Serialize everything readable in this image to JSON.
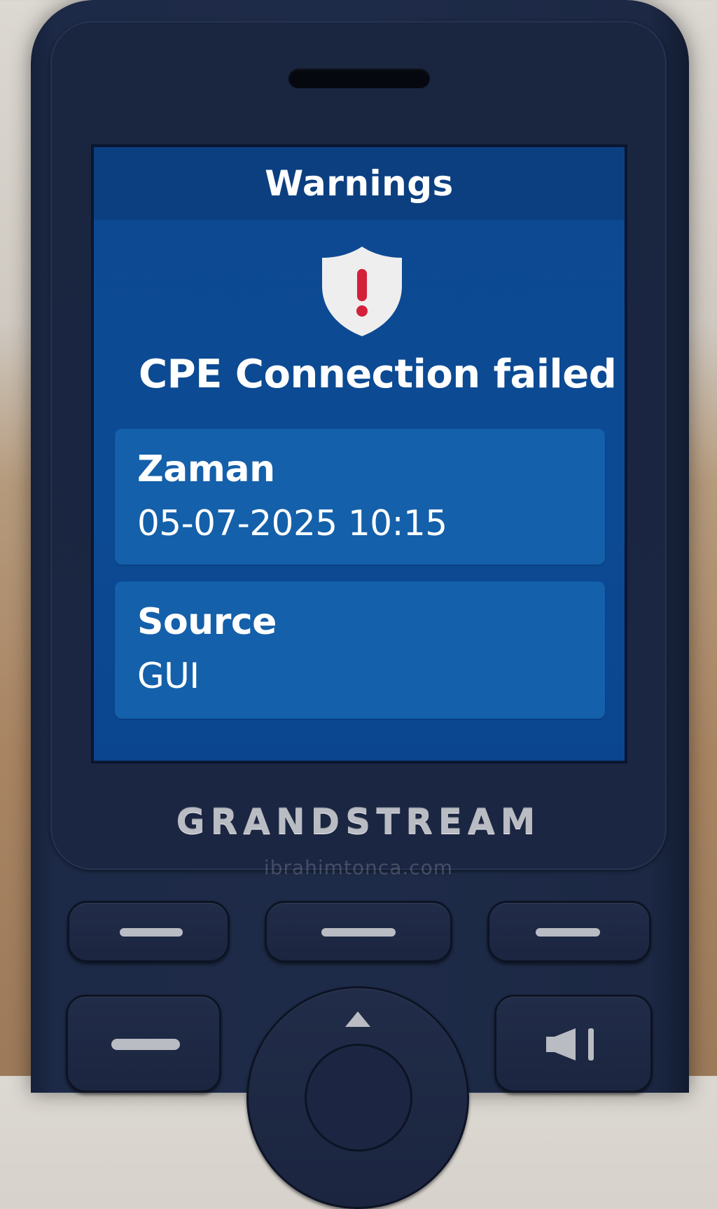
{
  "screen": {
    "title": "Warnings",
    "message": "CPE Connection failed",
    "cards": [
      {
        "label": "Zaman",
        "value": "05-07-2025 10:15"
      },
      {
        "label": "Source",
        "value": "GUI"
      }
    ]
  },
  "device": {
    "brand": "GRANDSTREAM",
    "watermark": "ibrahimtonca.com"
  },
  "icons": {
    "warning": "shield-alert-icon",
    "nav_up": "arrow-up-icon",
    "volume": "speaker-icon"
  },
  "colors": {
    "screen_bg": "#0c4a93",
    "header_bg": "#0c3f80",
    "card_bg": "#1460aa",
    "alert_red": "#d3213a",
    "phone_body": "#1e2b48"
  }
}
